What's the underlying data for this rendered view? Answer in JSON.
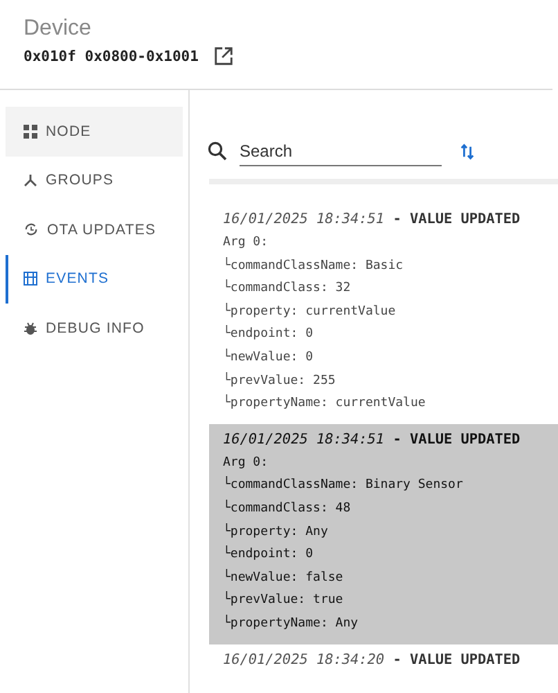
{
  "header": {
    "title": "Device",
    "device_id": "0x010f 0x0800-0x1001"
  },
  "sidebar": {
    "items": [
      {
        "label": "NODE",
        "kind": "grid",
        "selected": false,
        "hovered": true
      },
      {
        "label": "GROUPS",
        "kind": "fork",
        "selected": false,
        "hovered": false
      },
      {
        "label": "OTA UPDATES",
        "kind": "update",
        "selected": false,
        "hovered": false
      },
      {
        "label": "EVENTS",
        "kind": "list",
        "selected": true,
        "hovered": false
      },
      {
        "label": "DEBUG INFO",
        "kind": "bug",
        "selected": false,
        "hovered": false
      }
    ]
  },
  "search": {
    "placeholder": "Search"
  },
  "events": [
    {
      "time": "16/01/2025 18:34:51",
      "title": "- VALUE UPDATED",
      "selected": false,
      "arg": "Arg 0:",
      "lines": [
        "└commandClassName: Basic",
        "└commandClass: 32",
        "└property: currentValue",
        "└endpoint: 0",
        "└newValue: 0",
        "└prevValue: 255",
        "└propertyName: currentValue"
      ]
    },
    {
      "time": "16/01/2025 18:34:51",
      "title": "- VALUE UPDATED",
      "selected": true,
      "arg": "Arg 0:",
      "lines": [
        "└commandClassName: Binary Sensor",
        "└commandClass: 48",
        "└property: Any",
        "└endpoint: 0",
        "└newValue: false",
        "└prevValue: true",
        "└propertyName: Any"
      ]
    },
    {
      "time": "16/01/2025 18:34:20",
      "title": "- VALUE UPDATED",
      "selected": false
    }
  ]
}
